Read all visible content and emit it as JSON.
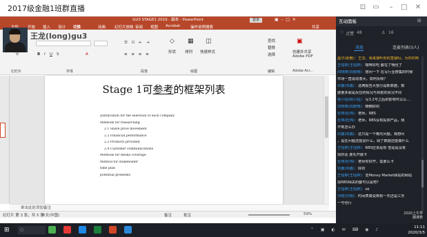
{
  "window": {
    "title": "2017级金融1班群直播"
  },
  "ppt": {
    "titlebar": "GU3 STAGE1 2019 - 副本 - PowerPoint",
    "login": "登录",
    "tabs": [
      "文件",
      "开始",
      "插入",
      "设计",
      "切换",
      "动画",
      "幻灯片放映",
      "审阅",
      "视图",
      "Acrobat",
      "操作说明搜索"
    ],
    "share": "共享",
    "ribbon": {
      "slides_group": "幻灯片",
      "font_group": "字体",
      "para_group": "段落",
      "draw_group": "绘图",
      "edit_group": "编辑",
      "adobe_group": "Adobe Acr...",
      "reset": "重置",
      "section": "节",
      "shape": "形状",
      "arrange": "排列",
      "quick_style": "快速样式",
      "find": "查找",
      "replace": "替换",
      "select": "选择",
      "create_share": "创建并共享",
      "adobe_pdf": "Adobe PDF"
    },
    "watermark": "王龙(long)gu3",
    "slide": {
      "title_pre": "Stage 1可",
      "title_ul": "参考",
      "title_post": "的框架列表",
      "toc": [
        {
          "num": "",
          "text": "Justification for the selection of each company"
        },
        {
          "num": "1.1",
          "text": "Methods for researching"
        },
        {
          "num": "1.2",
          "text": "2.1 Share price movement"
        },
        {
          "num": "1",
          "text": "2.2 Financial performance"
        },
        {
          "num": "1",
          "text": "2.3 Products provided"
        },
        {
          "num": "1",
          "text": "2.4 Customer communications"
        },
        {
          "num": "1.3",
          "text": "Methods for media coverage"
        },
        {
          "num": "1.4",
          "text": "Method for stakeholder"
        },
        {
          "num": "1.5",
          "text": "time plan"
        },
        {
          "num": "1.6",
          "text": "potential problems"
        }
      ]
    },
    "notes_placeholder": "单击此处添加备注",
    "status": {
      "slide": "幻灯片 第 3 张，共 5 张",
      "lang": "中文(中国)",
      "notes": "备注",
      "comments": "批注",
      "zoom": "59%"
    }
  },
  "panel": {
    "title": "互动面板",
    "likes": "48",
    "viewers": "16",
    "tabs": {
      "messages": "消息",
      "connect": "连麦列表(0人)"
    },
    "chat": [
      {
        "name": "昌华(助教)：",
        "text": "王龙，我来接听你的直播吗，为你的啊"
      },
      {
        "name": "王钰婷(王钰婷)：",
        "text": "咖啡好吃 都在了哦也了"
      },
      {
        "name": "向晓琦(向晓琦)：",
        "text": "想问一下 在写行业搜集的时候"
      },
      {
        "name": "",
        "text": "市场一直说动荡大，如何反映？"
      },
      {
        "name": "邓鑫(邓鑫)：",
        "text": "这两报告大部分是新数据，数"
      },
      {
        "name": "",
        "text": "据量多就是反应的情况与目前的状况不同"
      },
      {
        "name": "杨小钰(杨小钰)：",
        "text": "写3.2号之后的影响可以么…"
      },
      {
        "name": "向晓琦(向晓琦)：",
        "text": "喃喃好的"
      },
      {
        "name": "杜玮(杜玮)：",
        "text": "老师，RBS"
      },
      {
        "name": "杜玮(杜玮)：",
        "text": "老师，RBS没有投资产品，我"
      },
      {
        "name": "",
        "text": "不到怎么办"
      },
      {
        "name": "邓鑫(邓鑫)：",
        "text": "这只是一个曝光问题，我想问"
      },
      {
        "name": "",
        "text": "，是在问题还能说什么，除了数据还能做什么"
      },
      {
        "name": "王钰婷(王钰婷)：",
        "text": "RBS应该是有 但是是没有"
      },
      {
        "name": "",
        "text": "找的话 要先开展卡"
      },
      {
        "name": "杜玮(杜玮)：",
        "text": "老师你好开，需要么卡"
      },
      {
        "name": "邓鑫(邓鑫)：",
        "text": "好的"
      },
      {
        "name": "王钰婷(王钰婷)：",
        "text": "去Money Market网站的网站"
      },
      {
        "name": "",
        "text": "找RBS相关的都可以是吧?"
      },
      {
        "name": "王钰婷(王钰婷)：",
        "text": "ok"
      },
      {
        "name": "刘晓(刘晓)：",
        "text": "时间表真说到有一天还是三天"
      },
      {
        "name": "",
        "text": "一号也行"
      }
    ],
    "footer": [
      "2020上午学",
      "期课表"
    ]
  },
  "taskbar": {
    "time": "11:11",
    "date": "2020/3/5"
  },
  "colors": {
    "ppt_red": "#b7472a",
    "panel_bg": "#1f2229",
    "chat_name": "#3aa0f0"
  }
}
